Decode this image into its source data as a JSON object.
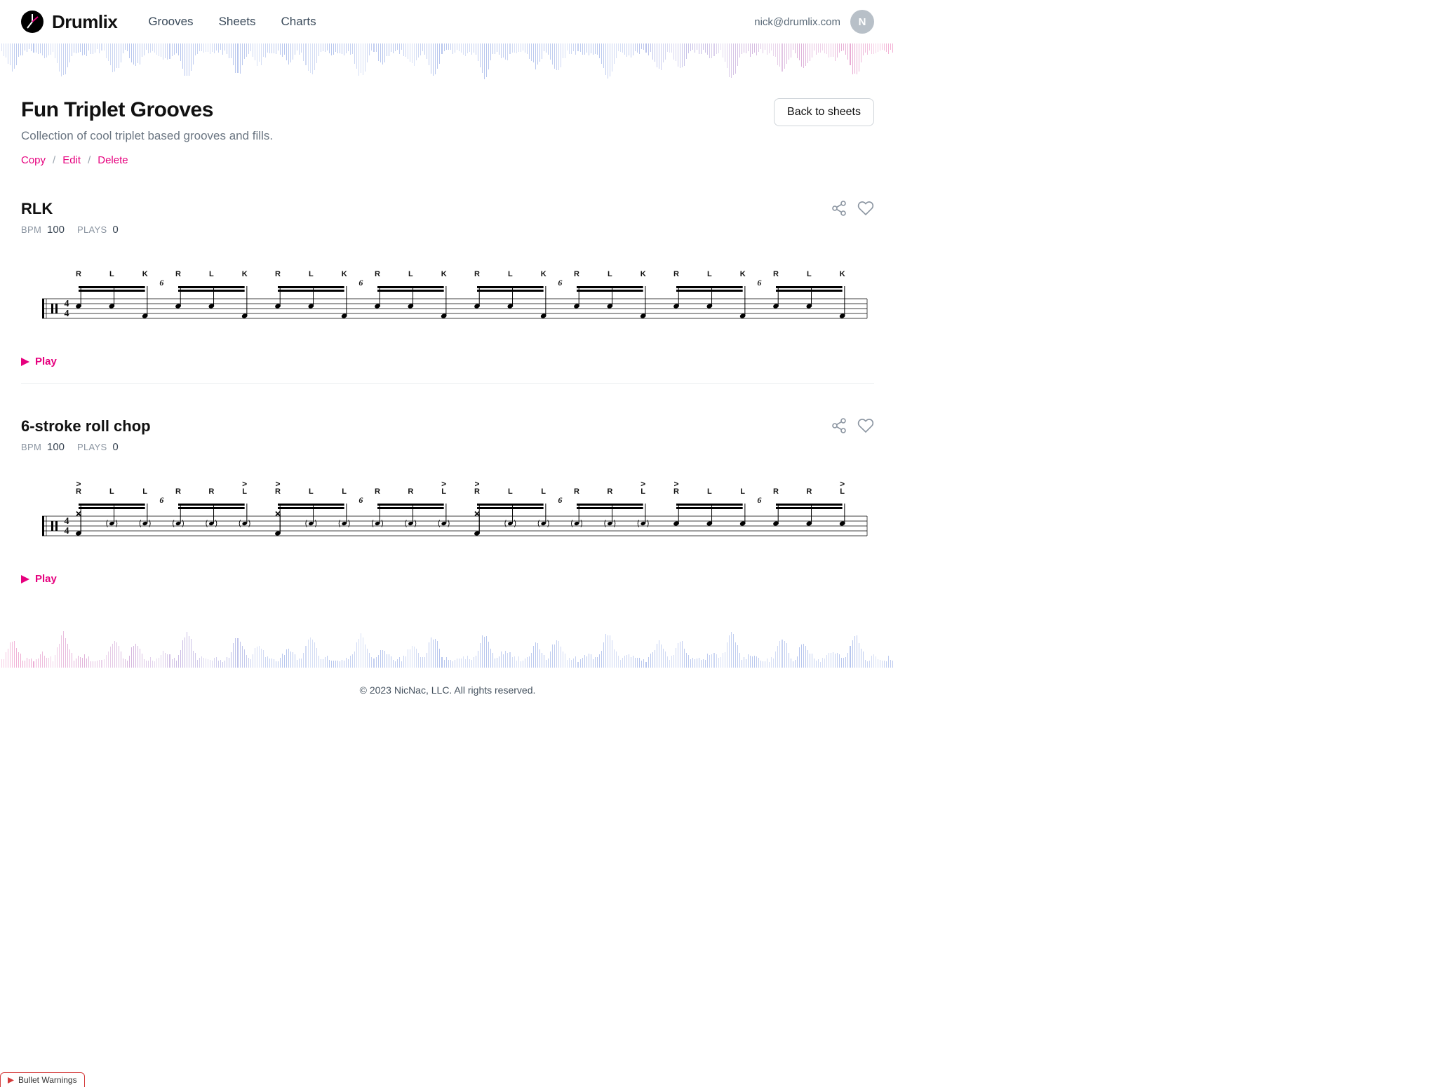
{
  "brand": "Drumlix",
  "nav": {
    "grooves": "Grooves",
    "sheets": "Sheets",
    "charts": "Charts"
  },
  "user": {
    "email": "nick@drumlix.com",
    "initial": "N"
  },
  "page": {
    "title": "Fun Triplet Grooves",
    "subtitle": "Collection of cool triplet based grooves and fills.",
    "back_label": "Back to sheets"
  },
  "actions": {
    "copy": "Copy",
    "edit": "Edit",
    "delete": "Delete"
  },
  "play_label": "Play",
  "footer": "© 2023 NicNac, LLC. All rights reserved.",
  "bullet_tab": "Bullet Warnings",
  "grooves": [
    {
      "title": "RLK",
      "bpm_label": "BPM",
      "bpm": "100",
      "plays_label": "PLAYS",
      "plays": "0",
      "time_signature": "4/4",
      "tuplet": "6",
      "sticking": [
        "R",
        "L",
        "K",
        "R",
        "L",
        "K",
        "R",
        "L",
        "K",
        "R",
        "L",
        "K",
        "R",
        "L",
        "K",
        "R",
        "L",
        "K",
        "R",
        "L",
        "K",
        "R",
        "L",
        "K"
      ],
      "accents": [],
      "kick_positions": [
        2,
        5,
        8,
        11,
        14,
        17,
        20,
        23
      ],
      "snare_positions": [
        0,
        1,
        3,
        4,
        6,
        7,
        9,
        10,
        12,
        13,
        15,
        16,
        18,
        19,
        21,
        22
      ],
      "hihat_positions": [],
      "ghost_positions": []
    },
    {
      "title": "6-stroke roll chop",
      "bpm_label": "BPM",
      "bpm": "100",
      "plays_label": "PLAYS",
      "plays": "0",
      "time_signature": "4/4",
      "tuplet": "6",
      "sticking": [
        "R",
        "L",
        "L",
        "R",
        "R",
        "L",
        "R",
        "L",
        "L",
        "R",
        "R",
        "L",
        "R",
        "L",
        "L",
        "R",
        "R",
        "L",
        "R",
        "L",
        "L",
        "R",
        "R",
        "L"
      ],
      "accents": [
        0,
        5,
        6,
        11,
        12,
        17,
        18,
        23
      ],
      "kick_positions": [
        0,
        6,
        12
      ],
      "snare_positions": [
        18,
        19,
        20,
        21,
        22,
        23
      ],
      "hihat_positions": [
        0,
        6,
        12
      ],
      "ghost_positions": [
        1,
        2,
        3,
        4,
        5,
        7,
        8,
        9,
        10,
        11,
        13,
        14,
        15,
        16,
        17
      ]
    }
  ]
}
